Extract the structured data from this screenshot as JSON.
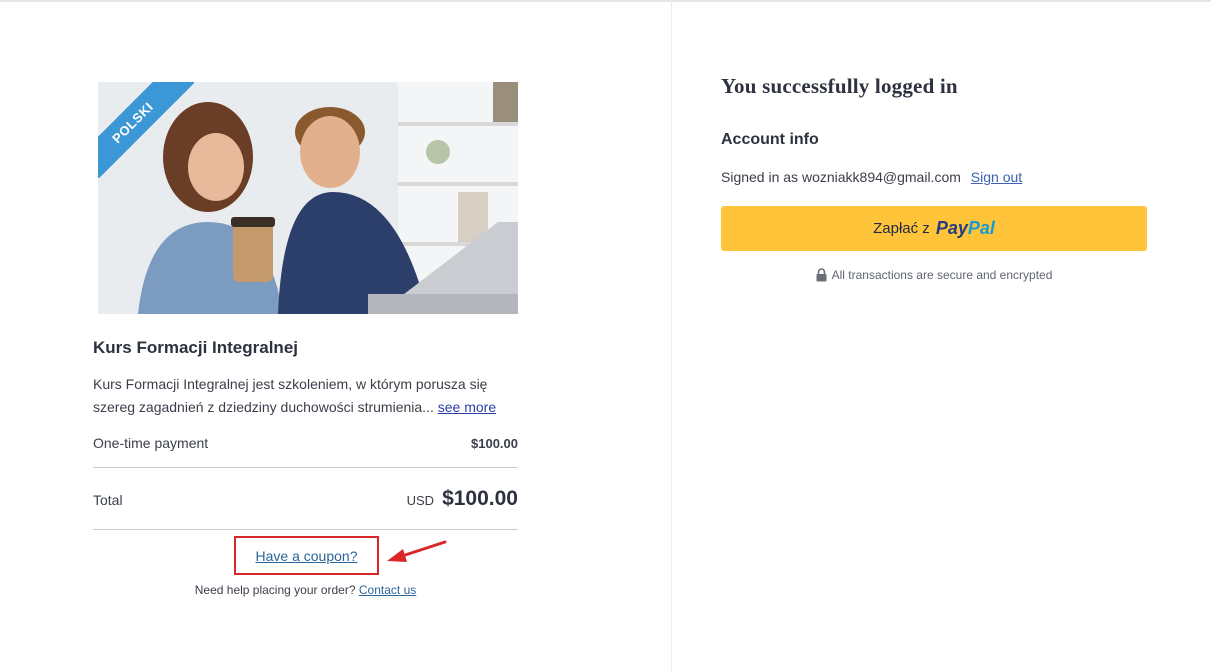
{
  "product": {
    "ribbon_label": "POLSKI",
    "title": "Kurs Formacji Integralnej",
    "description": "Kurs Formacji Integralnej jest szkoleniem, w którym porusza się szereg zagadnień z dziedziny duchowości strumienia...",
    "see_more": "see more"
  },
  "pricing": {
    "payment_label": "One-time payment",
    "payment_amount": "$100.00",
    "total_label": "Total",
    "currency": "USD",
    "total_amount": "$100.00"
  },
  "coupon": {
    "link": "Have a coupon?"
  },
  "help": {
    "text": "Need help placing your order?",
    "link": "Contact us"
  },
  "account": {
    "success_title": "You successfully logged in",
    "info_label": "Account info",
    "signed_in_prefix": "Signed in as",
    "email": "wozniakk894@gmail.com",
    "sign_out": "Sign out"
  },
  "paypal": {
    "prefix": "Zapłać z",
    "logo_pay": "Pay",
    "logo_pal": "Pal"
  },
  "secure_note": "All transactions are secure and encrypted",
  "colors": {
    "paypal_button": "#ffc439",
    "ribbon": "#3c97d6",
    "annotation_red": "#d9262b",
    "link_blue": "#2c6496"
  }
}
